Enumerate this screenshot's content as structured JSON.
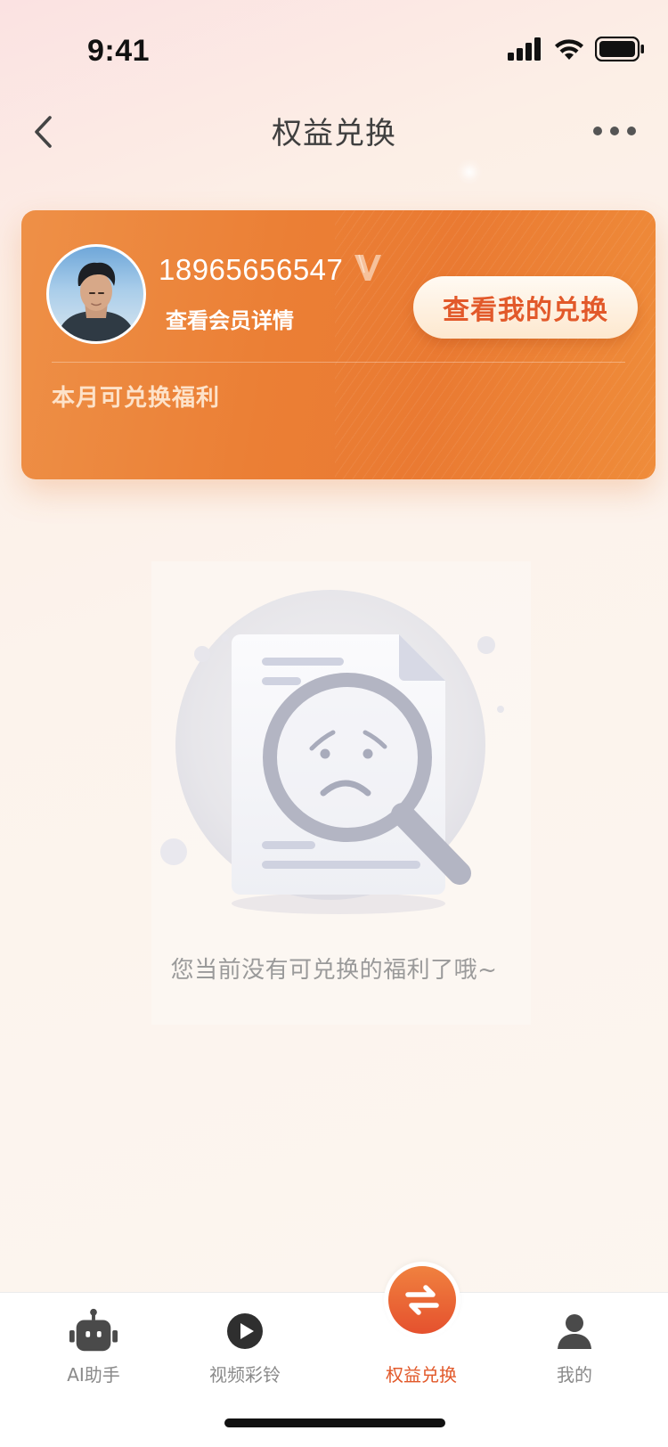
{
  "status_bar": {
    "time": "9:41",
    "signal_icon": "cellular-signal-icon",
    "wifi_icon": "wifi-icon",
    "battery_icon": "battery-icon"
  },
  "nav": {
    "title": "权益兑换",
    "back_icon": "chevron-left-icon",
    "more_icon": "more-dots-icon"
  },
  "member_card": {
    "phone": "18965656547",
    "vip_icon": "v-badge-icon",
    "details_link": "查看会员详情",
    "exchange_button": "查看我的兑换",
    "section_title": "本月可兑换福利",
    "accent_color": "#ea7a32",
    "button_text_color": "#e2592a"
  },
  "empty_state": {
    "illustration": "sad-magnifier-document-illustration",
    "message": "您当前没有可兑换的福利了哦~"
  },
  "tabbar": {
    "active_index": 2,
    "active_color": "#e2592a",
    "items": [
      {
        "label": "AI助手",
        "icon": "robot-icon"
      },
      {
        "label": "视频彩铃",
        "icon": "play-circle-icon"
      },
      {
        "label": "权益兑换",
        "icon": "exchange-arrows-icon"
      },
      {
        "label": "我的",
        "icon": "user-icon"
      }
    ]
  }
}
